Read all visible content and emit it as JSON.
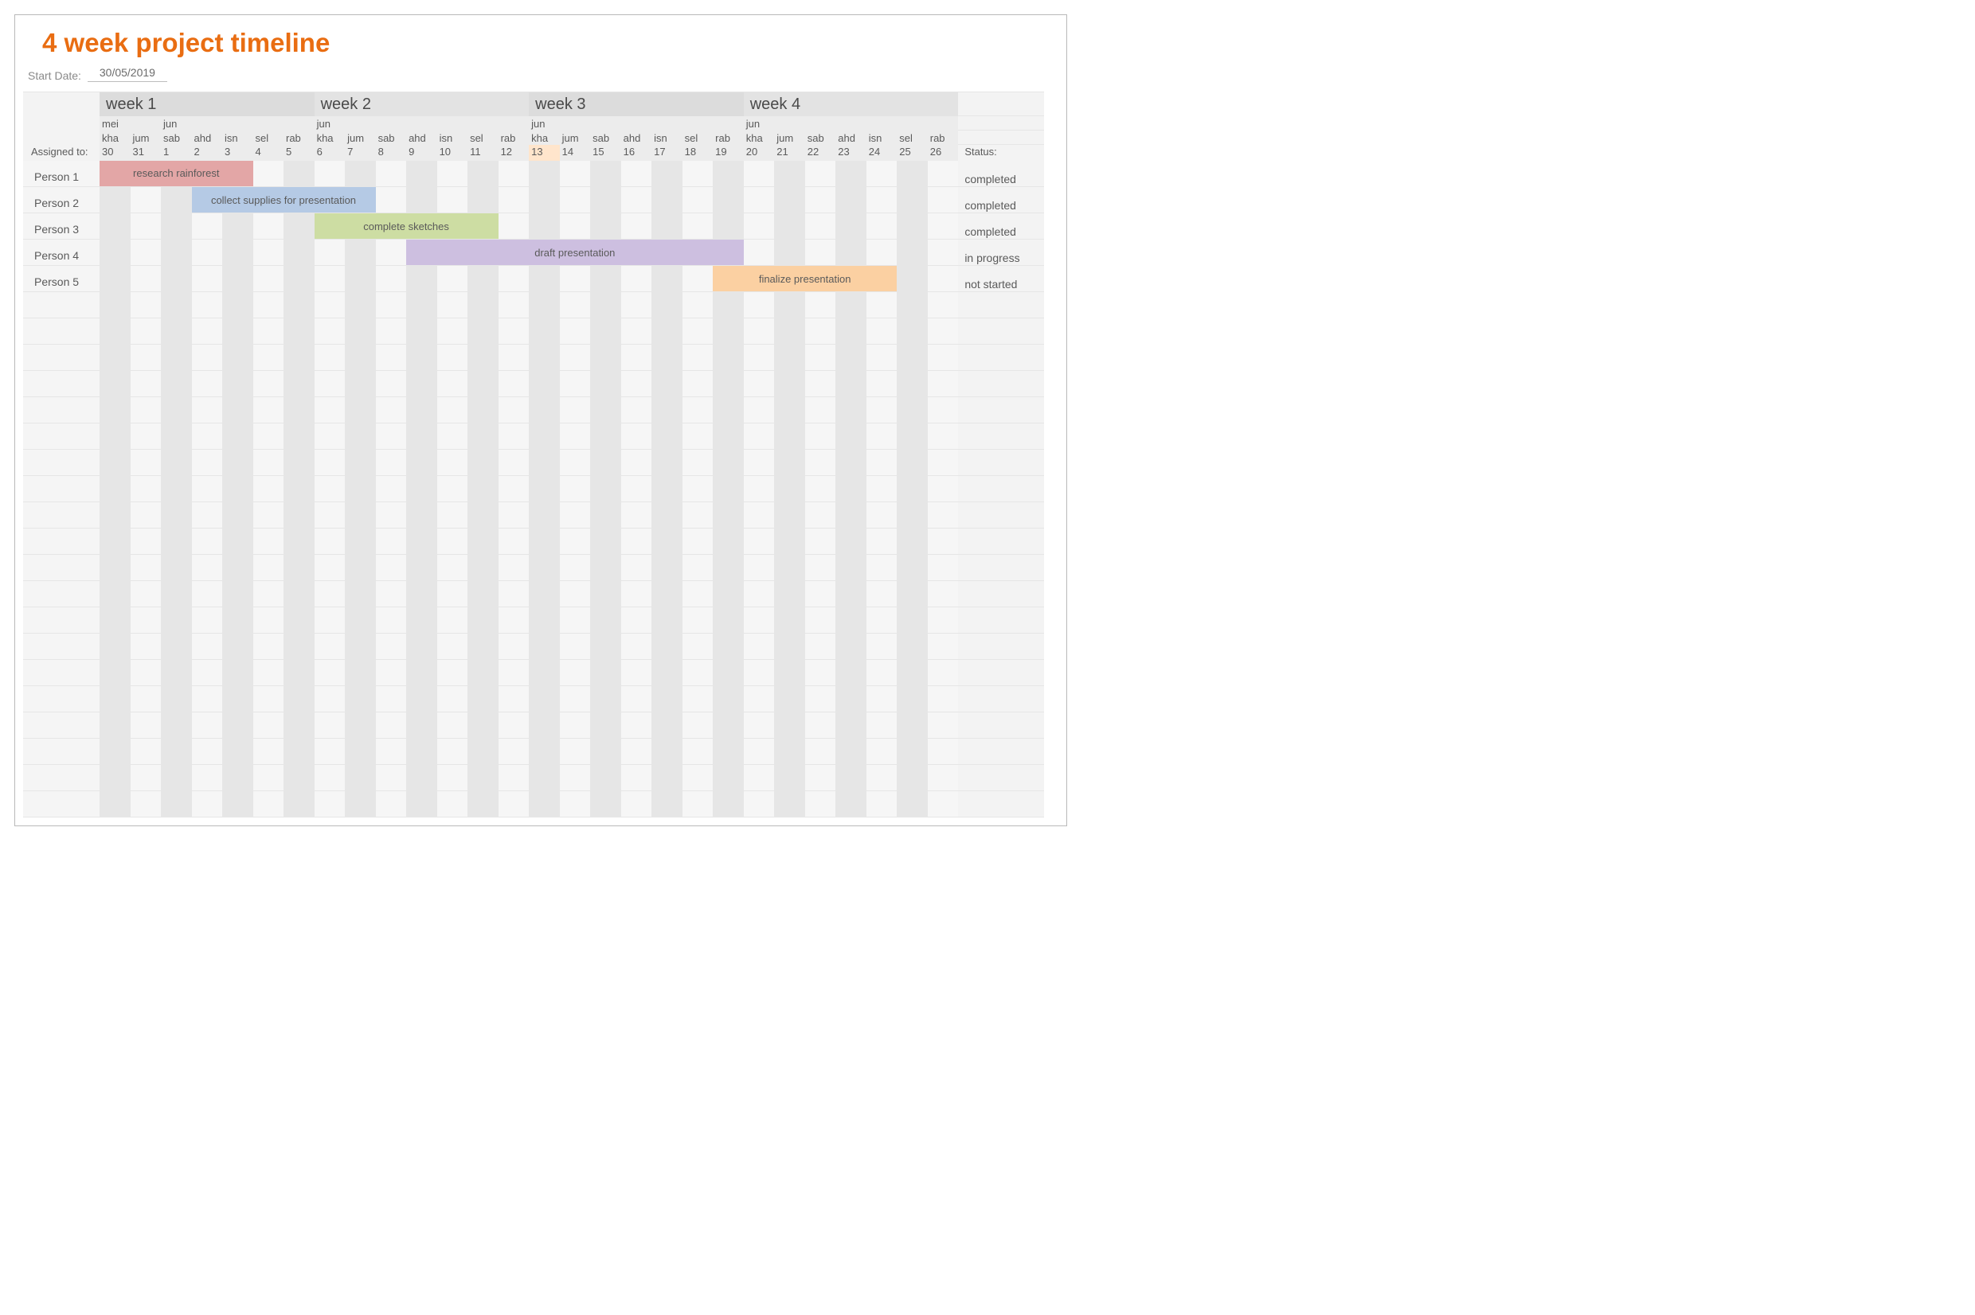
{
  "title": "4 week project timeline",
  "start_date_label": "Start Date:",
  "start_date_value": "30/05/2019",
  "assigned_label": "Assigned to:",
  "status_label": "Status:",
  "weeks": [
    "week 1",
    "week 2",
    "week 3",
    "week 4"
  ],
  "today_index": 14,
  "days": [
    {
      "month": "mei",
      "dow": "kha",
      "num": "30"
    },
    {
      "month": "",
      "dow": "jum",
      "num": "31"
    },
    {
      "month": "jun",
      "dow": "sab",
      "num": "1"
    },
    {
      "month": "",
      "dow": "ahd",
      "num": "2"
    },
    {
      "month": "",
      "dow": "isn",
      "num": "3"
    },
    {
      "month": "",
      "dow": "sel",
      "num": "4"
    },
    {
      "month": "",
      "dow": "rab",
      "num": "5"
    },
    {
      "month": "jun",
      "dow": "kha",
      "num": "6"
    },
    {
      "month": "",
      "dow": "jum",
      "num": "7"
    },
    {
      "month": "",
      "dow": "sab",
      "num": "8"
    },
    {
      "month": "",
      "dow": "ahd",
      "num": "9"
    },
    {
      "month": "",
      "dow": "isn",
      "num": "10"
    },
    {
      "month": "",
      "dow": "sel",
      "num": "11"
    },
    {
      "month": "",
      "dow": "rab",
      "num": "12"
    },
    {
      "month": "jun",
      "dow": "kha",
      "num": "13"
    },
    {
      "month": "",
      "dow": "jum",
      "num": "14"
    },
    {
      "month": "",
      "dow": "sab",
      "num": "15"
    },
    {
      "month": "",
      "dow": "ahd",
      "num": "16"
    },
    {
      "month": "",
      "dow": "isn",
      "num": "17"
    },
    {
      "month": "",
      "dow": "sel",
      "num": "18"
    },
    {
      "month": "",
      "dow": "rab",
      "num": "19"
    },
    {
      "month": "jun",
      "dow": "kha",
      "num": "20"
    },
    {
      "month": "",
      "dow": "jum",
      "num": "21"
    },
    {
      "month": "",
      "dow": "sab",
      "num": "22"
    },
    {
      "month": "",
      "dow": "ahd",
      "num": "23"
    },
    {
      "month": "",
      "dow": "isn",
      "num": "24"
    },
    {
      "month": "",
      "dow": "sel",
      "num": "25"
    },
    {
      "month": "",
      "dow": "rab",
      "num": "26"
    }
  ],
  "rows": [
    {
      "person": "Person 1",
      "status": "completed",
      "bar": {
        "start": 0,
        "span": 5,
        "label": "research rainforest",
        "color": "#e3a6a6"
      }
    },
    {
      "person": "Person 2",
      "status": "completed",
      "bar": {
        "start": 3,
        "span": 6,
        "label": "collect supplies for presentation",
        "color": "#b5cae5"
      }
    },
    {
      "person": "Person 3",
      "status": "completed",
      "bar": {
        "start": 7,
        "span": 6,
        "label": "complete sketches",
        "color": "#cddda3"
      }
    },
    {
      "person": "Person 4",
      "status": "in progress",
      "bar": {
        "start": 10,
        "span": 11,
        "label": "draft presentation",
        "color": "#cdbfe0"
      }
    },
    {
      "person": "Person 5",
      "status": "not started",
      "bar": {
        "start": 20,
        "span": 6,
        "label": "finalize presentation",
        "color": "#fbd0a2"
      }
    },
    {
      "person": "",
      "status": "",
      "bar": null
    },
    {
      "person": "",
      "status": "",
      "bar": null
    },
    {
      "person": "",
      "status": "",
      "bar": null
    },
    {
      "person": "",
      "status": "",
      "bar": null
    },
    {
      "person": "",
      "status": "",
      "bar": null
    },
    {
      "person": "",
      "status": "",
      "bar": null
    },
    {
      "person": "",
      "status": "",
      "bar": null
    },
    {
      "person": "",
      "status": "",
      "bar": null
    },
    {
      "person": "",
      "status": "",
      "bar": null
    },
    {
      "person": "",
      "status": "",
      "bar": null
    },
    {
      "person": "",
      "status": "",
      "bar": null
    },
    {
      "person": "",
      "status": "",
      "bar": null
    },
    {
      "person": "",
      "status": "",
      "bar": null
    },
    {
      "person": "",
      "status": "",
      "bar": null
    },
    {
      "person": "",
      "status": "",
      "bar": null
    },
    {
      "person": "",
      "status": "",
      "bar": null
    },
    {
      "person": "",
      "status": "",
      "bar": null
    },
    {
      "person": "",
      "status": "",
      "bar": null
    },
    {
      "person": "",
      "status": "",
      "bar": null
    },
    {
      "person": "",
      "status": "",
      "bar": null
    }
  ]
}
